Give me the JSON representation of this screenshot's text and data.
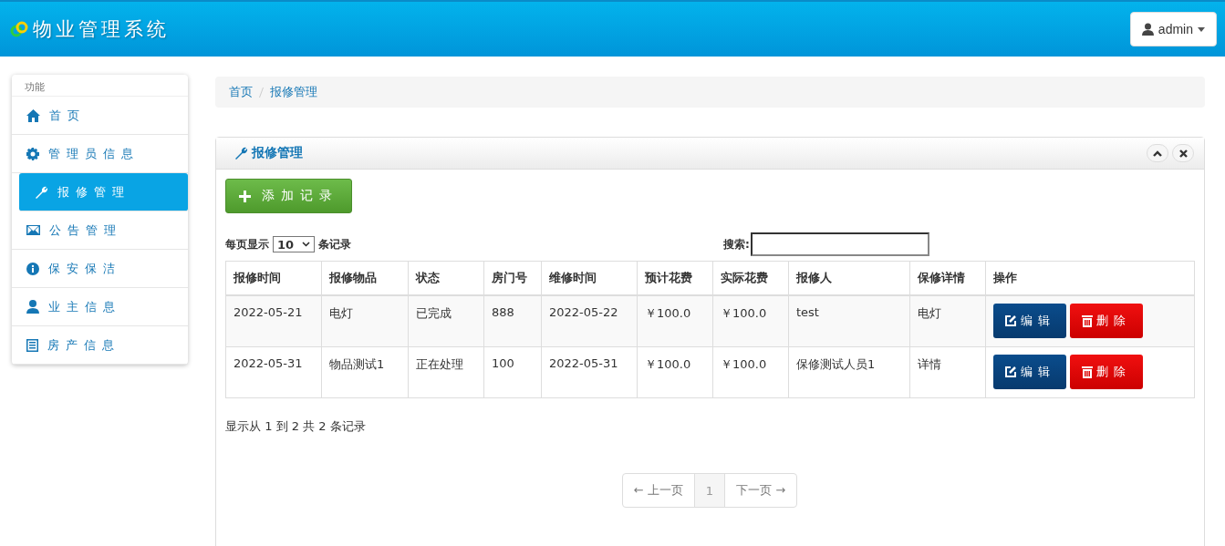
{
  "header": {
    "title": "物业管理系统",
    "user": "admin"
  },
  "sidebar": {
    "heading": "功能",
    "items": [
      {
        "label": "首页",
        "kind": "home",
        "selected": false
      },
      {
        "label": "管理员信息",
        "kind": "gear",
        "selected": false
      },
      {
        "label": "报修管理",
        "kind": "wrench",
        "selected": true
      },
      {
        "label": "公告管理",
        "kind": "envelope",
        "selected": false
      },
      {
        "label": "保安保洁",
        "kind": "info",
        "selected": false
      },
      {
        "label": "业主信息",
        "kind": "user",
        "selected": false
      },
      {
        "label": "房产信息",
        "kind": "list",
        "selected": false
      }
    ]
  },
  "breadcrumb": [
    "首页",
    "报修管理"
  ],
  "panel": {
    "title": "报修管理",
    "add_button": "添加记录",
    "page_size_label": "每页显示",
    "page_size": "10",
    "page_size_suffix": "条记录",
    "search_label": "搜索:",
    "table": {
      "columns": [
        "报修时间",
        "报修物品",
        "状态",
        "房门号",
        "维修时间",
        "预计花费",
        "实际花费",
        "报修人",
        "保修详情",
        "操作"
      ],
      "rows": [
        {
          "cells": [
            "2022-05-21",
            "电灯",
            "已完成",
            "888",
            "2022-05-22",
            "￥100.0",
            "￥100.0",
            "test",
            "电灯"
          ],
          "actions": [
            "编辑",
            "删除"
          ]
        },
        {
          "cells": [
            "2022-05-31",
            "物品测试1",
            "正在处理",
            "100",
            "2022-05-31",
            "￥100.0",
            "￥100.0",
            "保修测试人员1",
            "详情"
          ],
          "actions": [
            "编辑",
            "删除"
          ]
        }
      ]
    },
    "info": "显示从 1 到 2 共 2 条记录",
    "pagination": {
      "prev": "← 上一页",
      "pages": [
        {
          "label": "1",
          "selected": true
        }
      ],
      "next": "下一页 →"
    }
  }
}
